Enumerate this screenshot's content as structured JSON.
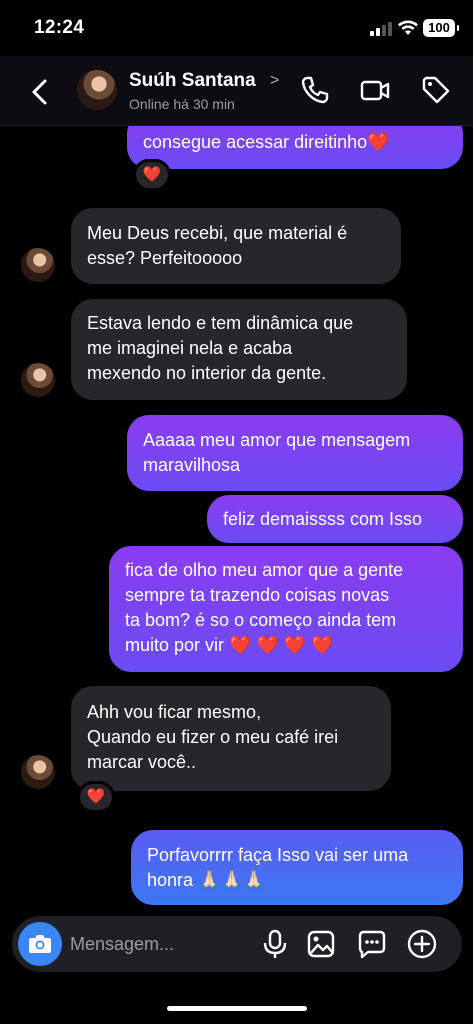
{
  "status_bar": {
    "time": "12:24",
    "battery": "100"
  },
  "header": {
    "contact_name": "Suúh Santana",
    "status": "Online há 30 min",
    "icons": [
      "back-arrow-icon",
      "phone-icon",
      "video-camera-icon",
      "tag-icon"
    ]
  },
  "messages": [
    {
      "sender": "me",
      "text": "consegue acessar direitinho",
      "emoji": "❤️",
      "reaction": "❤️"
    },
    {
      "sender": "contact",
      "lines": [
        "Meu Deus recebi, que material é",
        "esse? Perfeitooooo"
      ]
    },
    {
      "sender": "contact",
      "lines": [
        "Estava lendo e tem dinâmica que",
        "me imaginei nela e acaba",
        "mexendo no interior da gente."
      ]
    },
    {
      "sender": "me",
      "lines": [
        "Aaaaa meu amor que mensagem",
        "maravilhosa"
      ]
    },
    {
      "sender": "me",
      "lines": [
        "feliz demaissss com Isso"
      ]
    },
    {
      "sender": "me",
      "lines": [
        "fica de olho meu amor que a gente",
        "sempre ta trazendo coisas novas",
        "ta bom? é so o começo ainda tem",
        "muito por vir"
      ],
      "emoji": "❤️ ❤️ ❤️ ❤️"
    },
    {
      "sender": "contact",
      "lines": [
        "Ahh vou ficar mesmo,",
        "Quando eu fizer o meu café irei",
        "marcar você.."
      ],
      "reaction": "❤️"
    },
    {
      "sender": "me",
      "lines": [
        "Porfavorrrr faça Isso vai ser uma",
        "honra"
      ],
      "emoji": "🙏🏻🙏🏻🙏🏻"
    }
  ],
  "composer": {
    "placeholder": "Mensagem...",
    "icons": [
      "camera-icon",
      "microphone-icon",
      "gallery-icon",
      "sticker-icon",
      "plus-icon"
    ]
  },
  "colors": {
    "accent": "#3a86f4",
    "bubble_in": "#26262b",
    "bubble_out_top": "#8a3cf0",
    "bubble_out_bottom": "#3c78f2",
    "heart": "#ff2d4a"
  }
}
